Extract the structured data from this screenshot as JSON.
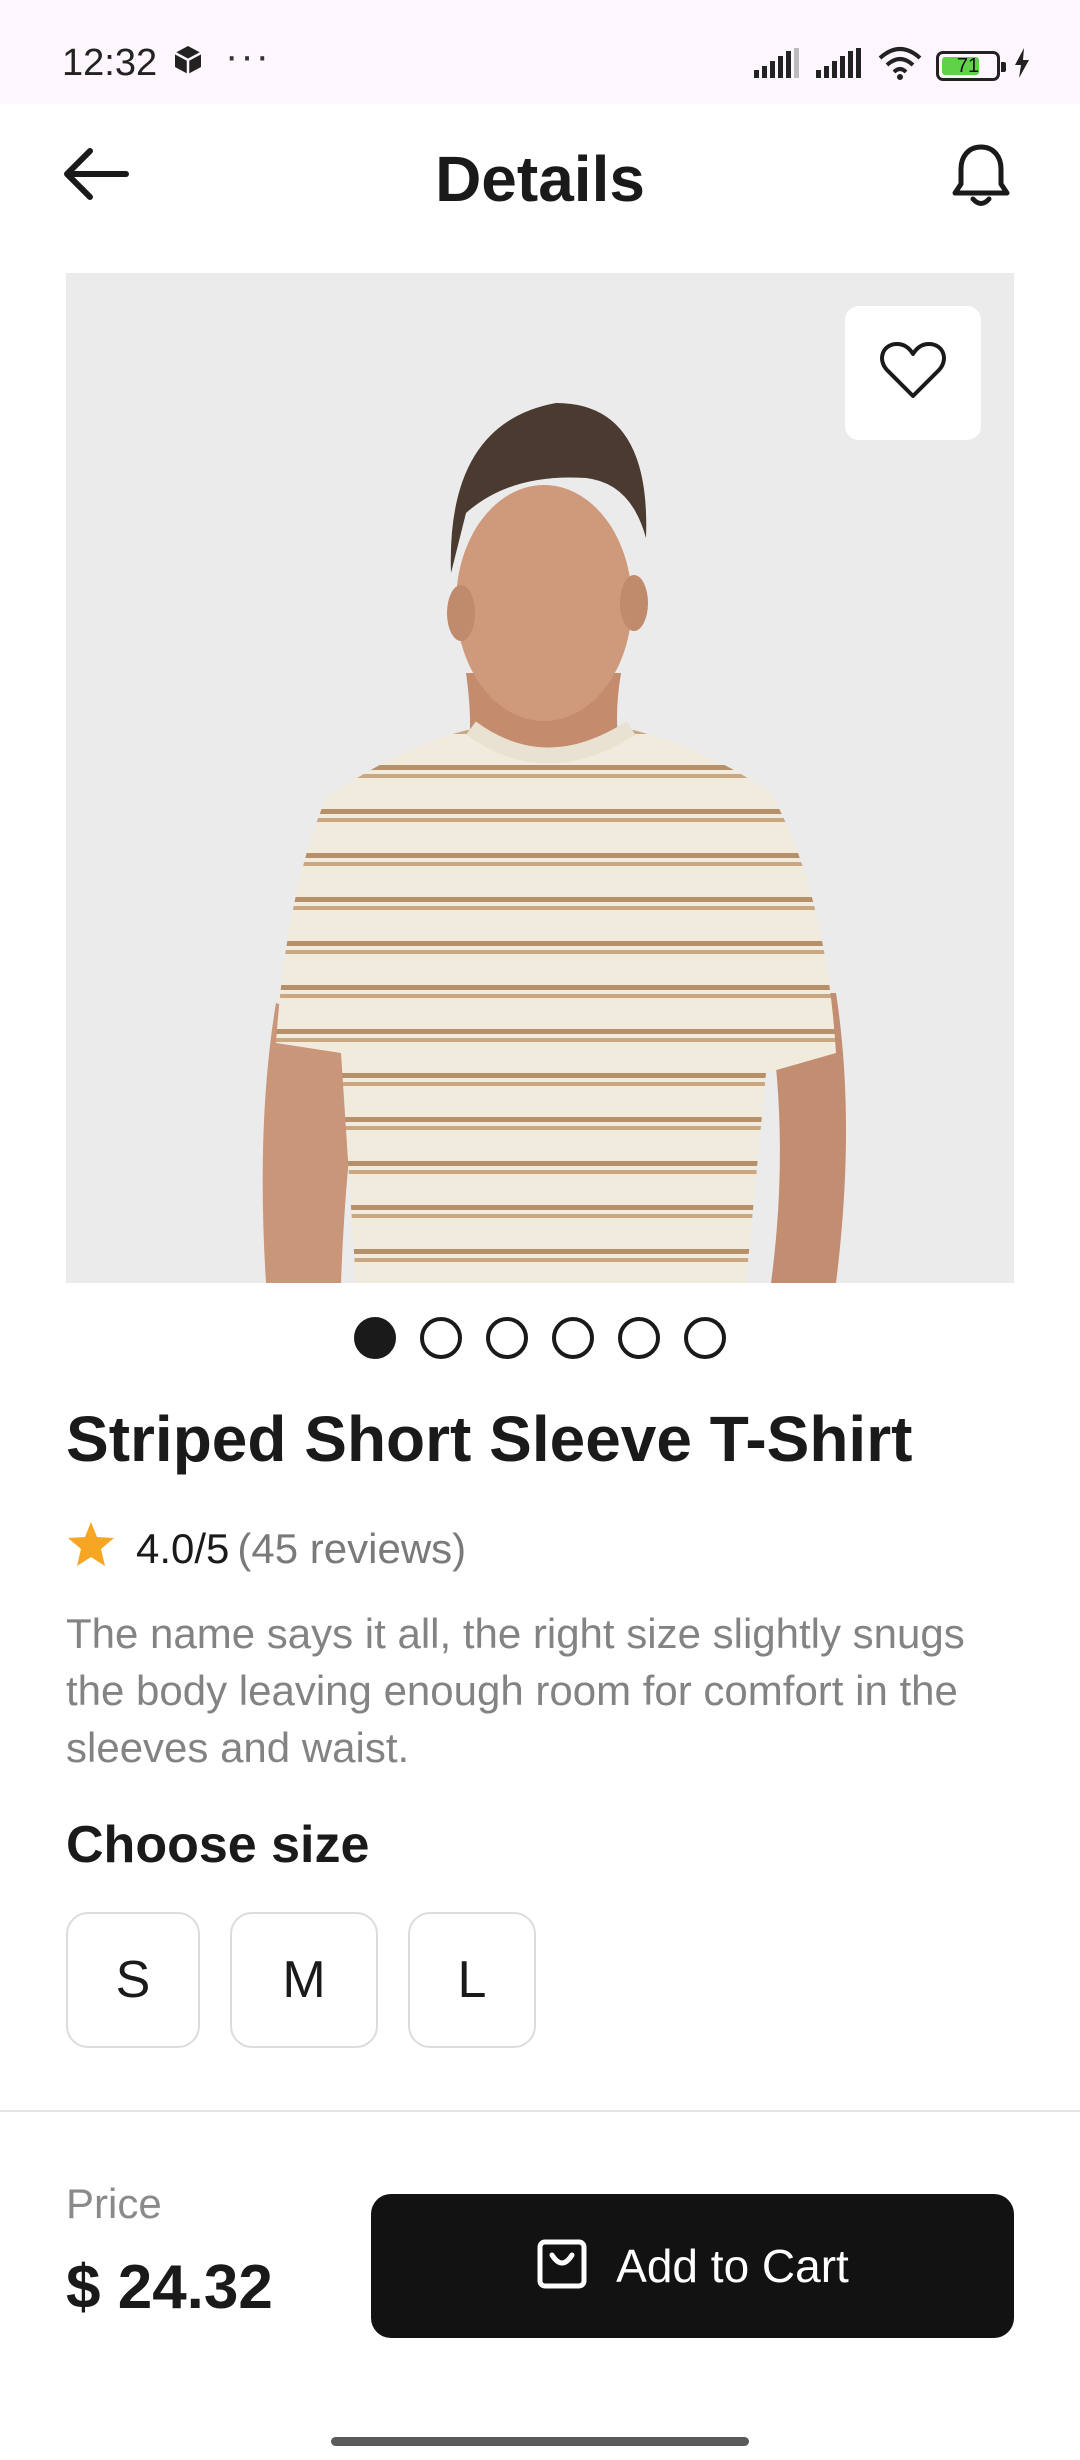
{
  "status_bar": {
    "time": "12:32",
    "more": "···",
    "battery_level": "71",
    "battery_fraction": 0.71,
    "icons": [
      "cube-icon",
      "signal-icon",
      "signal-icon",
      "wifi-icon",
      "battery-icon",
      "charging-icon"
    ]
  },
  "header": {
    "title": "Details",
    "back_icon": "arrow-left-icon",
    "bell_icon": "bell-icon"
  },
  "product": {
    "image_page_count": 6,
    "active_image_index": 0,
    "favorite_icon": "heart-icon",
    "title": "Striped Short Sleeve T-Shirt",
    "rating_value": "4.0/5",
    "rating_count": "(45 reviews)",
    "description": "The name says it all, the right size slightly snugs the body leaving enough room for comfort in the sleeves and waist."
  },
  "size": {
    "heading": "Choose size",
    "options": [
      "S",
      "M",
      "L"
    ]
  },
  "footer": {
    "price_label": "Price",
    "price_value": "$ 24.32",
    "cart_label": "Add to Cart",
    "cart_icon": "shopping-bag-icon"
  },
  "colors": {
    "accent": "#121212",
    "star": "#f6a623",
    "battery": "#5fd247"
  }
}
